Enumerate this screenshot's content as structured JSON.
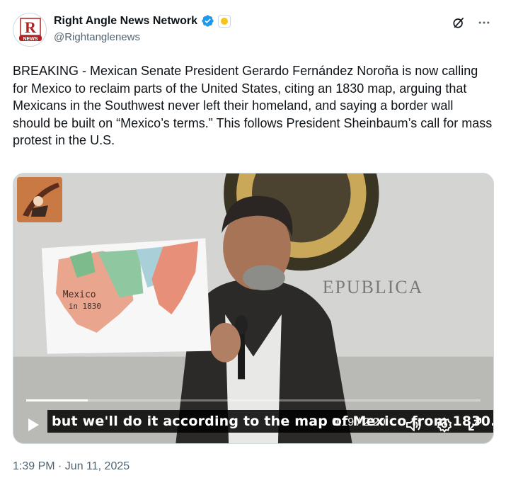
{
  "author": {
    "display_name": "Right Angle News Network",
    "handle": "@Rightanglenews",
    "avatar_text": "R",
    "avatar_subtext": "NEWS"
  },
  "tweet": {
    "text": "BREAKING - Mexican Senate President Gerardo Fernández Noroña is now calling for Mexico to reclaim parts of the United States, citing an 1830 map, arguing that Mexicans in the Southwest never left their homeland, and saying a border wall should be built on “Mexico’s terms.” This follows President Sheinbaum’s call for mass protest in the U.S.",
    "timestamp": "1:39 PM · Jun 11, 2025"
  },
  "video": {
    "caption": "but we'll do it according to the map of Mexico from 1830.\"",
    "elapsed": "0:19",
    "duration": "2:20",
    "time_display": "0:19 / 2:20",
    "progress": 0.136,
    "map_label_1": "Mexico",
    "map_label_2": "in 1830",
    "wall_text": "EPUBLICA"
  },
  "icons": {
    "verified": "verified-badge-icon",
    "affiliate": "affiliate-badge-icon",
    "grok": "grok-icon",
    "more": "more-icon",
    "play": "play-icon",
    "volume": "volume-icon",
    "settings": "gear-icon",
    "fullscreen": "expand-icon"
  },
  "colors": {
    "verified_blue": "#1d9bf0",
    "text_primary": "#0f1419",
    "text_secondary": "#536471"
  }
}
